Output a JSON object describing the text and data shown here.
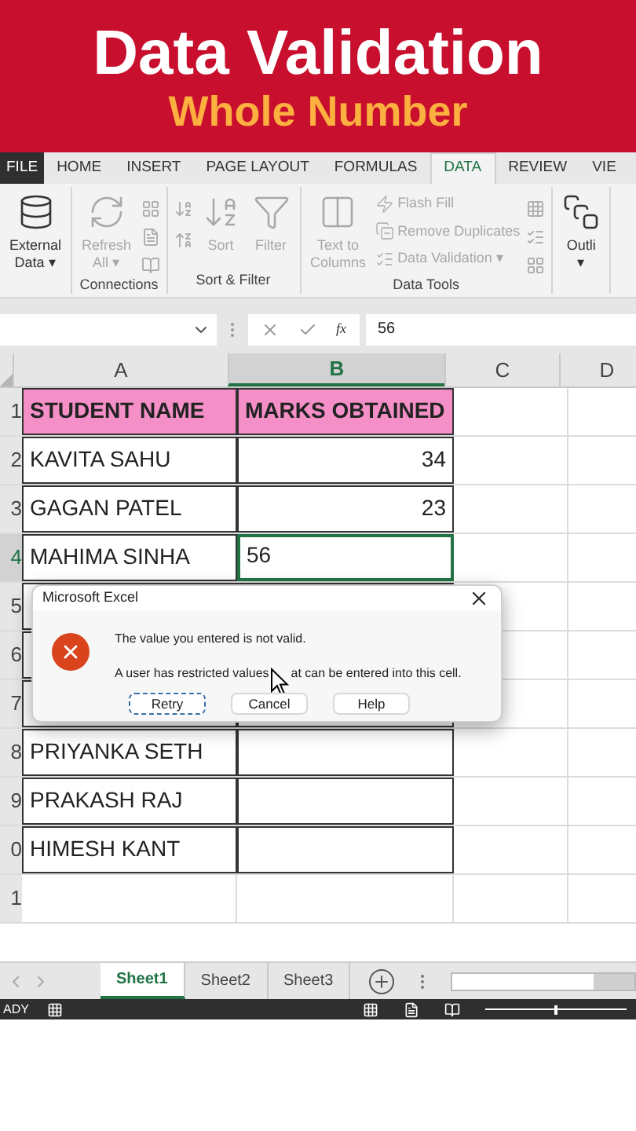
{
  "banner": {
    "title": "Data Validation",
    "subtitle": "Whole Number"
  },
  "ribbon_tabs": [
    {
      "label": "FILE",
      "kind": "file",
      "selected": false
    },
    {
      "label": "HOME",
      "kind": "tab",
      "selected": false
    },
    {
      "label": "INSERT",
      "kind": "tab",
      "selected": false
    },
    {
      "label": "PAGE LAYOUT",
      "kind": "tab",
      "selected": false
    },
    {
      "label": "FORMULAS",
      "kind": "tab",
      "selected": false
    },
    {
      "label": "DATA",
      "kind": "tab",
      "selected": true
    },
    {
      "label": "REVIEW",
      "kind": "tab",
      "selected": false
    },
    {
      "label": "VIE",
      "kind": "tab",
      "selected": false
    }
  ],
  "ribbon_groups": [
    {
      "commands": [
        {
          "kind": "large",
          "lines": [
            "External",
            "Data ▾"
          ],
          "disabled": false
        }
      ]
    },
    {
      "label": "Connections",
      "commands": [
        {
          "kind": "large",
          "lines": [
            "Refresh",
            "All ▾"
          ],
          "disabled": true
        }
      ]
    },
    {
      "label": "Sort & Filter",
      "commands": [
        {
          "kind": "large",
          "lines": [
            "Sort"
          ],
          "disabled": true
        },
        {
          "kind": "large",
          "lines": [
            "Filter"
          ],
          "disabled": true
        }
      ]
    },
    {
      "label": "Data Tools",
      "commands": [
        {
          "kind": "large",
          "lines": [
            "Text to",
            "Columns"
          ],
          "disabled": true
        },
        {
          "kind": "small",
          "lines": [
            "Flash Fill"
          ],
          "disabled": true
        },
        {
          "kind": "small",
          "lines": [
            "Remove Duplicates"
          ],
          "disabled": true
        },
        {
          "kind": "small",
          "lines": [
            "Data Validation ▾"
          ],
          "disabled": true
        }
      ]
    },
    {
      "commands": [
        {
          "kind": "large",
          "lines": [
            "Outli",
            "▾"
          ],
          "disabled": false
        }
      ]
    }
  ],
  "formula_bar": {
    "function_label": "fx",
    "value": "56"
  },
  "columns": [
    {
      "label": "A",
      "selected": false
    },
    {
      "label": "B",
      "selected": true
    },
    {
      "label": "C",
      "selected": false
    },
    {
      "label": "D",
      "selected": false
    }
  ],
  "rows": [
    {
      "header": "1",
      "selected": false,
      "cells": [
        {
          "kind": "header",
          "text": "STUDENT NAME",
          "selected": false
        },
        {
          "kind": "header",
          "text": "MARKS OBTAINED",
          "selected": false
        }
      ]
    },
    {
      "header": "2",
      "selected": false,
      "cells": [
        {
          "kind": "text",
          "text": "KAVITA SAHU",
          "selected": false
        },
        {
          "kind": "number",
          "text": "34",
          "selected": false
        }
      ]
    },
    {
      "header": "3",
      "selected": false,
      "cells": [
        {
          "kind": "text",
          "text": "GAGAN PATEL",
          "selected": false
        },
        {
          "kind": "number",
          "text": "23",
          "selected": false
        }
      ]
    },
    {
      "header": "4",
      "selected": true,
      "cells": [
        {
          "kind": "text",
          "text": "MAHIMA SINHA",
          "selected": false
        },
        {
          "kind": "text",
          "text": "56",
          "selected": true
        }
      ]
    },
    {
      "header": "5",
      "selected": false,
      "cells": [
        {
          "kind": "text"
        },
        {
          "kind": "number"
        }
      ]
    },
    {
      "header": "6",
      "selected": false,
      "cells": [
        {
          "kind": "text"
        }
      ]
    },
    {
      "header": "7",
      "selected": false,
      "cells": [
        {
          "kind": "text"
        },
        {
          "kind": "number"
        }
      ]
    },
    {
      "header": "8",
      "selected": false,
      "cells": [
        {
          "kind": "text",
          "text": "PRIYANKA SETH",
          "selected": false
        },
        {
          "kind": "number",
          "selected": false
        }
      ]
    },
    {
      "header": "9",
      "selected": false,
      "cells": [
        {
          "kind": "text",
          "text": "PRAKASH RAJ",
          "selected": false
        },
        {
          "kind": "number",
          "selected": false
        }
      ]
    },
    {
      "header": "0",
      "selected": false,
      "cells": [
        {
          "kind": "text",
          "text": "HIMESH KANT",
          "selected": false
        },
        {
          "kind": "number",
          "selected": false
        }
      ]
    },
    {
      "header": "1",
      "selected": false,
      "cells": []
    }
  ],
  "dialog": {
    "title": "Microsoft Excel",
    "messages": [
      {
        "parts": [
          "The value you entered is not valid."
        ]
      },
      {
        "parts": [
          "A user has restricted values",
          "at can be entered into this cell."
        ]
      }
    ],
    "buttons": [
      {
        "label": "Retry",
        "focused": true
      },
      {
        "label": "Cancel",
        "focused": false
      },
      {
        "label": "Help",
        "focused": false
      }
    ]
  },
  "sheet_tabs": [
    {
      "label": "Sheet1",
      "selected": true
    },
    {
      "label": "Sheet2",
      "selected": false
    },
    {
      "label": "Sheet3",
      "selected": false
    }
  ],
  "status_bar": {
    "text": "ADY"
  },
  "zoom_slider": {
    "level": 0.5
  }
}
